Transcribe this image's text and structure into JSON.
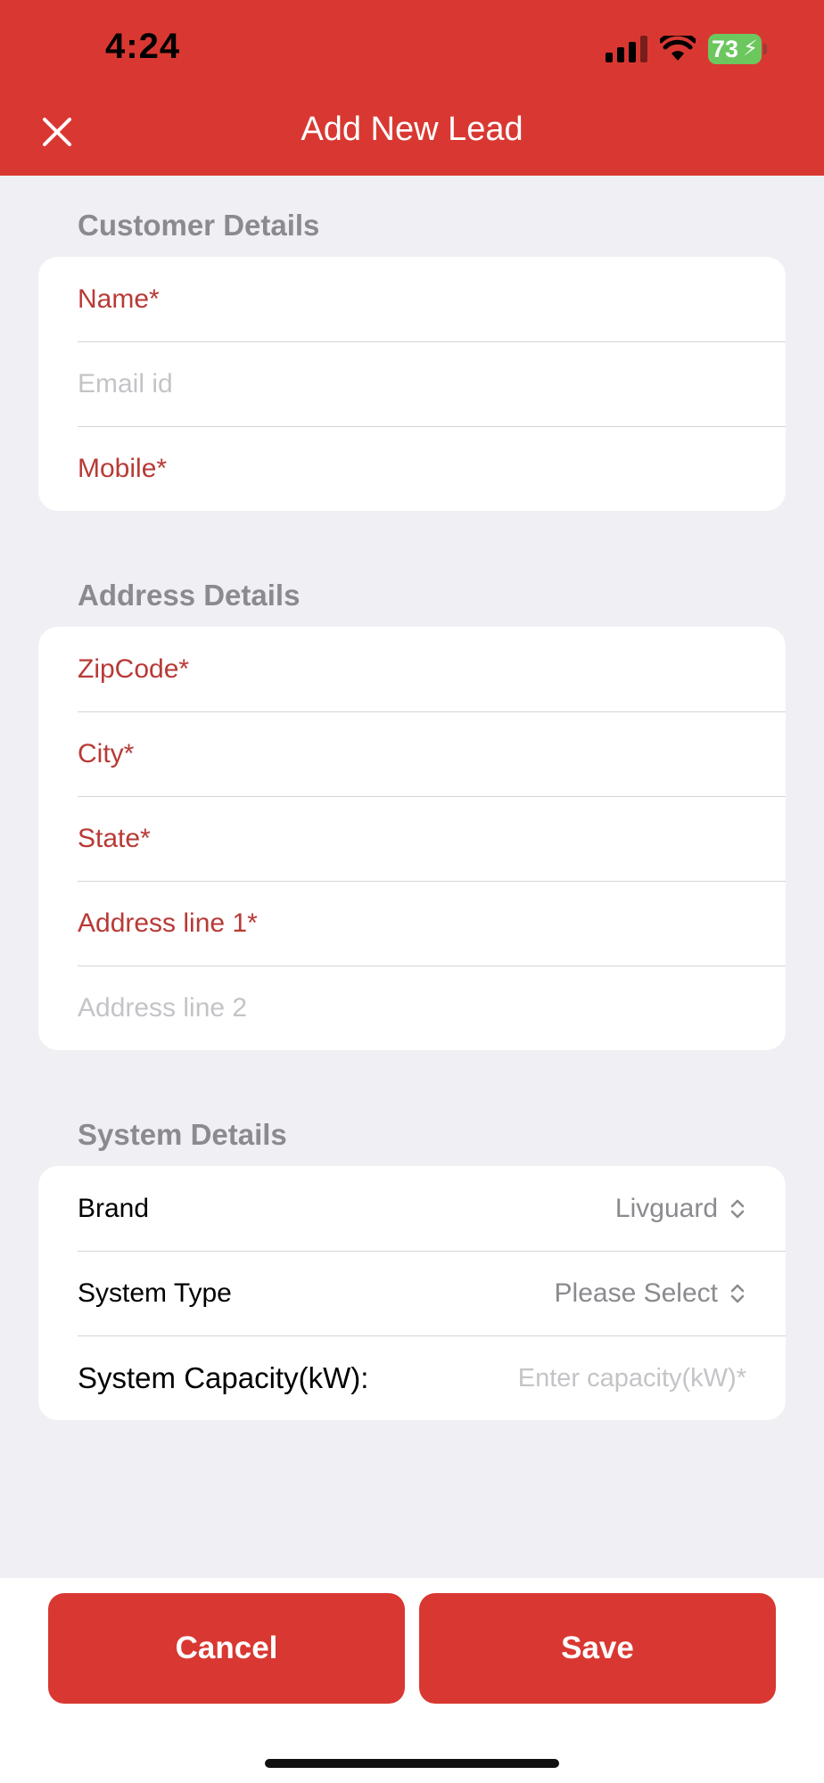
{
  "status_bar": {
    "time": "4:24",
    "battery": "73"
  },
  "header": {
    "title": "Add New Lead"
  },
  "customer": {
    "title": "Customer Details",
    "name_placeholder": "Name*",
    "email_placeholder": "Email id",
    "mobile_placeholder": "Mobile*"
  },
  "address": {
    "title": "Address Details",
    "zip_placeholder": "ZipCode*",
    "city_placeholder": "City*",
    "state_placeholder": "State*",
    "line1_placeholder": "Address line 1*",
    "line2_placeholder": "Address line 2"
  },
  "system": {
    "title": "System Details",
    "brand_label": "Brand",
    "brand_value": "Livguard",
    "type_label": "System Type",
    "type_value": "Please Select",
    "capacity_label": "System Capacity(kW):",
    "capacity_placeholder": "Enter capacity(kW)*"
  },
  "actions": {
    "cancel": "Cancel",
    "save": "Save"
  },
  "colors": {
    "accent": "#d93832",
    "required_text": "#b83a36",
    "background": "#efeff4"
  },
  "icons": {
    "close": "close-icon",
    "signal": "cellular-signal-icon",
    "wifi": "wifi-icon",
    "battery": "battery-charging-icon",
    "chevron": "up-down-chevron-icon"
  }
}
